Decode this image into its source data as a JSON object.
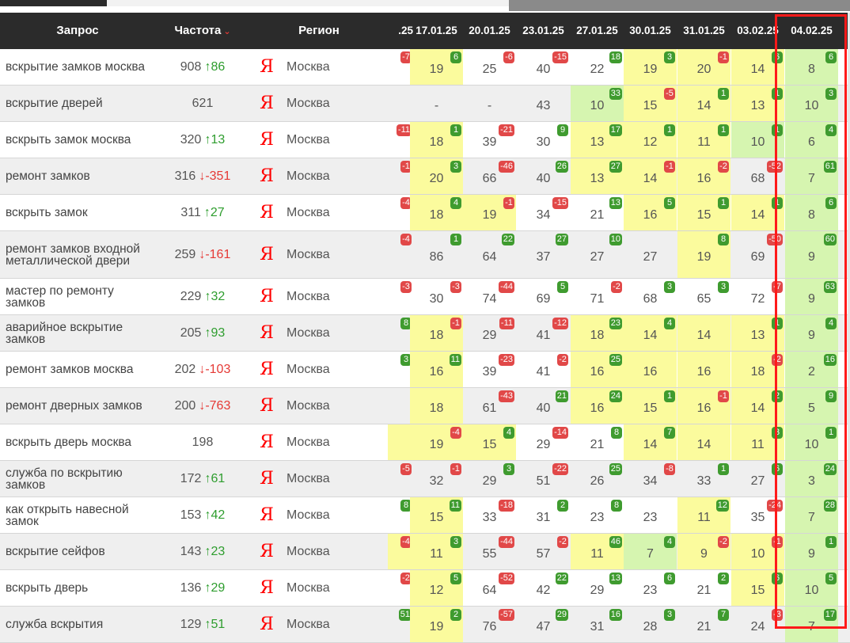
{
  "colors": {
    "yellow": "#fbfb9d",
    "green": "#d6f5b0",
    "gray": "#e7e7e7",
    "none": "transparent",
    "highlight": "#ff1a1a"
  },
  "header": {
    "query": "Запрос",
    "freq": "Частота",
    "region": "Регион",
    "sort_icon": "chevron-down-icon",
    "dates": [
      ".25",
      "17.01.25",
      "20.01.25",
      "23.01.25",
      "27.01.25",
      "30.01.25",
      "31.01.25",
      "03.02.25",
      "04.02.25"
    ]
  },
  "rows": [
    {
      "query": "вскрытие замков москва",
      "freq": "908",
      "delta": "↑86",
      "dir": "up",
      "engine": "Я",
      "region": "Москва",
      "cells": [
        {
          "v": "",
          "b": "-7",
          "t": "r",
          "c": "none"
        },
        {
          "v": "19",
          "b": "6",
          "t": "g",
          "c": "yellow"
        },
        {
          "v": "25",
          "b": "-6",
          "t": "r",
          "c": "none"
        },
        {
          "v": "40",
          "b": "-15",
          "t": "r",
          "c": "none"
        },
        {
          "v": "22",
          "b": "18",
          "t": "g",
          "c": "none"
        },
        {
          "v": "19",
          "b": "3",
          "t": "g",
          "c": "yellow"
        },
        {
          "v": "20",
          "b": "-1",
          "t": "r",
          "c": "yellow"
        },
        {
          "v": "14",
          "b": "6",
          "t": "g",
          "c": "yellow"
        },
        {
          "v": "8",
          "b": "6",
          "t": "g",
          "c": "green"
        }
      ]
    },
    {
      "query": "вскрытие дверей",
      "freq": "621",
      "delta": "",
      "dir": "",
      "engine": "Я",
      "region": "Москва",
      "cells": [
        {
          "v": "",
          "b": "",
          "t": "",
          "c": "none"
        },
        {
          "v": "-",
          "b": "",
          "t": "",
          "c": "none"
        },
        {
          "v": "-",
          "b": "",
          "t": "",
          "c": "none"
        },
        {
          "v": "43",
          "b": "",
          "t": "",
          "c": "none"
        },
        {
          "v": "10",
          "b": "33",
          "t": "g",
          "c": "green"
        },
        {
          "v": "15",
          "b": "-5",
          "t": "r",
          "c": "yellow"
        },
        {
          "v": "14",
          "b": "1",
          "t": "g",
          "c": "yellow"
        },
        {
          "v": "13",
          "b": "1",
          "t": "g",
          "c": "yellow"
        },
        {
          "v": "10",
          "b": "3",
          "t": "g",
          "c": "green"
        }
      ]
    },
    {
      "query": "вскрыть замок москва",
      "freq": "320",
      "delta": "↑13",
      "dir": "up",
      "engine": "Я",
      "region": "Москва",
      "cells": [
        {
          "v": "",
          "b": "-11",
          "t": "r",
          "c": "none"
        },
        {
          "v": "18",
          "b": "1",
          "t": "g",
          "c": "yellow"
        },
        {
          "v": "39",
          "b": "-21",
          "t": "r",
          "c": "none"
        },
        {
          "v": "30",
          "b": "9",
          "t": "g",
          "c": "none"
        },
        {
          "v": "13",
          "b": "17",
          "t": "g",
          "c": "yellow"
        },
        {
          "v": "12",
          "b": "1",
          "t": "g",
          "c": "yellow"
        },
        {
          "v": "11",
          "b": "1",
          "t": "g",
          "c": "yellow"
        },
        {
          "v": "10",
          "b": "1",
          "t": "g",
          "c": "green"
        },
        {
          "v": "6",
          "b": "4",
          "t": "g",
          "c": "green"
        }
      ]
    },
    {
      "query": "ремонт замков",
      "freq": "316",
      "delta": "↓-351",
      "dir": "down",
      "engine": "Я",
      "region": "Москва",
      "cells": [
        {
          "v": "",
          "b": "-1",
          "t": "r",
          "c": "none"
        },
        {
          "v": "20",
          "b": "3",
          "t": "g",
          "c": "yellow"
        },
        {
          "v": "66",
          "b": "-46",
          "t": "r",
          "c": "none"
        },
        {
          "v": "40",
          "b": "26",
          "t": "g",
          "c": "none"
        },
        {
          "v": "13",
          "b": "27",
          "t": "g",
          "c": "yellow"
        },
        {
          "v": "14",
          "b": "-1",
          "t": "r",
          "c": "yellow"
        },
        {
          "v": "16",
          "b": "-2",
          "t": "r",
          "c": "yellow"
        },
        {
          "v": "68",
          "b": "-52",
          "t": "r",
          "c": "none"
        },
        {
          "v": "7",
          "b": "61",
          "t": "g",
          "c": "green"
        }
      ]
    },
    {
      "query": "вскрыть замок",
      "freq": "311",
      "delta": "↑27",
      "dir": "up",
      "engine": "Я",
      "region": "Москва",
      "cells": [
        {
          "v": "",
          "b": "-4",
          "t": "r",
          "c": "none"
        },
        {
          "v": "18",
          "b": "4",
          "t": "g",
          "c": "yellow"
        },
        {
          "v": "19",
          "b": "-1",
          "t": "r",
          "c": "yellow"
        },
        {
          "v": "34",
          "b": "-15",
          "t": "r",
          "c": "none"
        },
        {
          "v": "21",
          "b": "13",
          "t": "g",
          "c": "none"
        },
        {
          "v": "16",
          "b": "5",
          "t": "g",
          "c": "yellow"
        },
        {
          "v": "15",
          "b": "1",
          "t": "g",
          "c": "yellow"
        },
        {
          "v": "14",
          "b": "1",
          "t": "g",
          "c": "yellow"
        },
        {
          "v": "8",
          "b": "6",
          "t": "g",
          "c": "green"
        }
      ]
    },
    {
      "query": "ремонт замков входной металлической двери",
      "freq": "259",
      "delta": "↓-161",
      "dir": "down",
      "engine": "Я",
      "region": "Москва",
      "cells": [
        {
          "v": "",
          "b": "-4",
          "t": "r",
          "c": "none"
        },
        {
          "v": "86",
          "b": "1",
          "t": "g",
          "c": "none"
        },
        {
          "v": "64",
          "b": "22",
          "t": "g",
          "c": "none"
        },
        {
          "v": "37",
          "b": "27",
          "t": "g",
          "c": "none"
        },
        {
          "v": "27",
          "b": "10",
          "t": "g",
          "c": "none"
        },
        {
          "v": "27",
          "b": "",
          "t": "",
          "c": "none"
        },
        {
          "v": "19",
          "b": "8",
          "t": "g",
          "c": "yellow"
        },
        {
          "v": "69",
          "b": "-50",
          "t": "r",
          "c": "none"
        },
        {
          "v": "9",
          "b": "60",
          "t": "g",
          "c": "green"
        }
      ]
    },
    {
      "query": "мастер по ремонту замков",
      "freq": "229",
      "delta": "↑32",
      "dir": "up",
      "engine": "Я",
      "region": "Москва",
      "cells": [
        {
          "v": "",
          "b": "-3",
          "t": "r",
          "c": "none"
        },
        {
          "v": "30",
          "b": "-3",
          "t": "r",
          "c": "none"
        },
        {
          "v": "74",
          "b": "-44",
          "t": "r",
          "c": "none"
        },
        {
          "v": "69",
          "b": "5",
          "t": "g",
          "c": "none"
        },
        {
          "v": "71",
          "b": "-2",
          "t": "r",
          "c": "none"
        },
        {
          "v": "68",
          "b": "3",
          "t": "g",
          "c": "none"
        },
        {
          "v": "65",
          "b": "3",
          "t": "g",
          "c": "none"
        },
        {
          "v": "72",
          "b": "-7",
          "t": "r",
          "c": "none"
        },
        {
          "v": "9",
          "b": "63",
          "t": "g",
          "c": "green"
        }
      ]
    },
    {
      "query": "аварийное вскрытие замков",
      "freq": "205",
      "delta": "↑93",
      "dir": "up",
      "engine": "Я",
      "region": "Москва",
      "cells": [
        {
          "v": "",
          "b": "8",
          "t": "g",
          "c": "none"
        },
        {
          "v": "18",
          "b": "-1",
          "t": "r",
          "c": "yellow"
        },
        {
          "v": "29",
          "b": "-11",
          "t": "r",
          "c": "none"
        },
        {
          "v": "41",
          "b": "-12",
          "t": "r",
          "c": "none"
        },
        {
          "v": "18",
          "b": "23",
          "t": "g",
          "c": "yellow"
        },
        {
          "v": "14",
          "b": "4",
          "t": "g",
          "c": "yellow"
        },
        {
          "v": "14",
          "b": "",
          "t": "",
          "c": "yellow"
        },
        {
          "v": "13",
          "b": "1",
          "t": "g",
          "c": "yellow"
        },
        {
          "v": "9",
          "b": "4",
          "t": "g",
          "c": "green"
        }
      ]
    },
    {
      "query": "ремонт замков москва",
      "freq": "202",
      "delta": "↓-103",
      "dir": "down",
      "engine": "Я",
      "region": "Москва",
      "cells": [
        {
          "v": "",
          "b": "3",
          "t": "g",
          "c": "none"
        },
        {
          "v": "16",
          "b": "11",
          "t": "g",
          "c": "yellow"
        },
        {
          "v": "39",
          "b": "-23",
          "t": "r",
          "c": "none"
        },
        {
          "v": "41",
          "b": "-2",
          "t": "r",
          "c": "none"
        },
        {
          "v": "16",
          "b": "25",
          "t": "g",
          "c": "yellow"
        },
        {
          "v": "16",
          "b": "",
          "t": "",
          "c": "yellow"
        },
        {
          "v": "16",
          "b": "",
          "t": "",
          "c": "yellow"
        },
        {
          "v": "18",
          "b": "-2",
          "t": "r",
          "c": "yellow"
        },
        {
          "v": "2",
          "b": "16",
          "t": "g",
          "c": "green"
        }
      ]
    },
    {
      "query": "ремонт дверных замков",
      "freq": "200",
      "delta": "↓-763",
      "dir": "down",
      "engine": "Я",
      "region": "Москва",
      "cells": [
        {
          "v": "",
          "b": "",
          "t": "",
          "c": "none"
        },
        {
          "v": "18",
          "b": "",
          "t": "",
          "c": "yellow"
        },
        {
          "v": "61",
          "b": "-43",
          "t": "r",
          "c": "none"
        },
        {
          "v": "40",
          "b": "21",
          "t": "g",
          "c": "none"
        },
        {
          "v": "16",
          "b": "24",
          "t": "g",
          "c": "yellow"
        },
        {
          "v": "15",
          "b": "1",
          "t": "g",
          "c": "yellow"
        },
        {
          "v": "16",
          "b": "-1",
          "t": "r",
          "c": "yellow"
        },
        {
          "v": "14",
          "b": "2",
          "t": "g",
          "c": "yellow"
        },
        {
          "v": "5",
          "b": "9",
          "t": "g",
          "c": "green"
        }
      ]
    },
    {
      "query": "вскрыть дверь москва",
      "freq": "198",
      "delta": "",
      "dir": "",
      "engine": "Я",
      "region": "Москва",
      "cells": [
        {
          "v": "",
          "b": "",
          "t": "",
          "c": "yellow"
        },
        {
          "v": "19",
          "b": "-4",
          "t": "r",
          "c": "yellow"
        },
        {
          "v": "15",
          "b": "4",
          "t": "g",
          "c": "yellow"
        },
        {
          "v": "29",
          "b": "-14",
          "t": "r",
          "c": "none"
        },
        {
          "v": "21",
          "b": "8",
          "t": "g",
          "c": "none"
        },
        {
          "v": "14",
          "b": "7",
          "t": "g",
          "c": "yellow"
        },
        {
          "v": "14",
          "b": "",
          "t": "",
          "c": "yellow"
        },
        {
          "v": "11",
          "b": "3",
          "t": "g",
          "c": "yellow"
        },
        {
          "v": "10",
          "b": "1",
          "t": "g",
          "c": "green"
        }
      ]
    },
    {
      "query": "служба по вскрытию замков",
      "freq": "172",
      "delta": "↑61",
      "dir": "up",
      "engine": "Я",
      "region": "Москва",
      "cells": [
        {
          "v": "",
          "b": "-5",
          "t": "r",
          "c": "none"
        },
        {
          "v": "32",
          "b": "-1",
          "t": "r",
          "c": "none"
        },
        {
          "v": "29",
          "b": "3",
          "t": "g",
          "c": "none"
        },
        {
          "v": "51",
          "b": "-22",
          "t": "r",
          "c": "none"
        },
        {
          "v": "26",
          "b": "25",
          "t": "g",
          "c": "none"
        },
        {
          "v": "34",
          "b": "-8",
          "t": "r",
          "c": "none"
        },
        {
          "v": "33",
          "b": "1",
          "t": "g",
          "c": "none"
        },
        {
          "v": "27",
          "b": "6",
          "t": "g",
          "c": "none"
        },
        {
          "v": "3",
          "b": "24",
          "t": "g",
          "c": "green"
        }
      ]
    },
    {
      "query": "как открыть навесной замок",
      "freq": "153",
      "delta": "↑42",
      "dir": "up",
      "engine": "Я",
      "region": "Москва",
      "cells": [
        {
          "v": "",
          "b": "8",
          "t": "g",
          "c": "none"
        },
        {
          "v": "15",
          "b": "11",
          "t": "g",
          "c": "yellow"
        },
        {
          "v": "33",
          "b": "-18",
          "t": "r",
          "c": "none"
        },
        {
          "v": "31",
          "b": "2",
          "t": "g",
          "c": "none"
        },
        {
          "v": "23",
          "b": "8",
          "t": "g",
          "c": "none"
        },
        {
          "v": "23",
          "b": "",
          "t": "",
          "c": "none"
        },
        {
          "v": "11",
          "b": "12",
          "t": "g",
          "c": "yellow"
        },
        {
          "v": "35",
          "b": "-24",
          "t": "r",
          "c": "none"
        },
        {
          "v": "7",
          "b": "28",
          "t": "g",
          "c": "green"
        }
      ]
    },
    {
      "query": "вскрытие сейфов",
      "freq": "143",
      "delta": "↑23",
      "dir": "up",
      "engine": "Я",
      "region": "Москва",
      "cells": [
        {
          "v": "",
          "b": "-4",
          "t": "r",
          "c": "yellow"
        },
        {
          "v": "11",
          "b": "3",
          "t": "g",
          "c": "yellow"
        },
        {
          "v": "55",
          "b": "-44",
          "t": "r",
          "c": "none"
        },
        {
          "v": "57",
          "b": "-2",
          "t": "r",
          "c": "none"
        },
        {
          "v": "11",
          "b": "46",
          "t": "g",
          "c": "yellow"
        },
        {
          "v": "7",
          "b": "4",
          "t": "g",
          "c": "green"
        },
        {
          "v": "9",
          "b": "-2",
          "t": "r",
          "c": "yellow"
        },
        {
          "v": "10",
          "b": "-1",
          "t": "r",
          "c": "yellow"
        },
        {
          "v": "9",
          "b": "1",
          "t": "g",
          "c": "green"
        }
      ]
    },
    {
      "query": "вскрыть дверь",
      "freq": "136",
      "delta": "↑29",
      "dir": "up",
      "engine": "Я",
      "region": "Москва",
      "cells": [
        {
          "v": "",
          "b": "-2",
          "t": "r",
          "c": "none"
        },
        {
          "v": "12",
          "b": "5",
          "t": "g",
          "c": "yellow"
        },
        {
          "v": "64",
          "b": "-52",
          "t": "r",
          "c": "none"
        },
        {
          "v": "42",
          "b": "22",
          "t": "g",
          "c": "none"
        },
        {
          "v": "29",
          "b": "13",
          "t": "g",
          "c": "none"
        },
        {
          "v": "23",
          "b": "6",
          "t": "g",
          "c": "none"
        },
        {
          "v": "21",
          "b": "2",
          "t": "g",
          "c": "none"
        },
        {
          "v": "15",
          "b": "6",
          "t": "g",
          "c": "yellow"
        },
        {
          "v": "10",
          "b": "5",
          "t": "g",
          "c": "green"
        }
      ]
    },
    {
      "query": "служба вскрытия",
      "freq": "129",
      "delta": "↑51",
      "dir": "up",
      "engine": "Я",
      "region": "Москва",
      "cells": [
        {
          "v": "",
          "b": "51",
          "t": "g",
          "c": "none"
        },
        {
          "v": "19",
          "b": "2",
          "t": "g",
          "c": "yellow"
        },
        {
          "v": "76",
          "b": "-57",
          "t": "r",
          "c": "none"
        },
        {
          "v": "47",
          "b": "29",
          "t": "g",
          "c": "none"
        },
        {
          "v": "31",
          "b": "16",
          "t": "g",
          "c": "none"
        },
        {
          "v": "28",
          "b": "3",
          "t": "g",
          "c": "none"
        },
        {
          "v": "21",
          "b": "7",
          "t": "g",
          "c": "none"
        },
        {
          "v": "24",
          "b": "-3",
          "t": "r",
          "c": "none"
        },
        {
          "v": "7",
          "b": "17",
          "t": "g",
          "c": "green"
        }
      ]
    }
  ]
}
